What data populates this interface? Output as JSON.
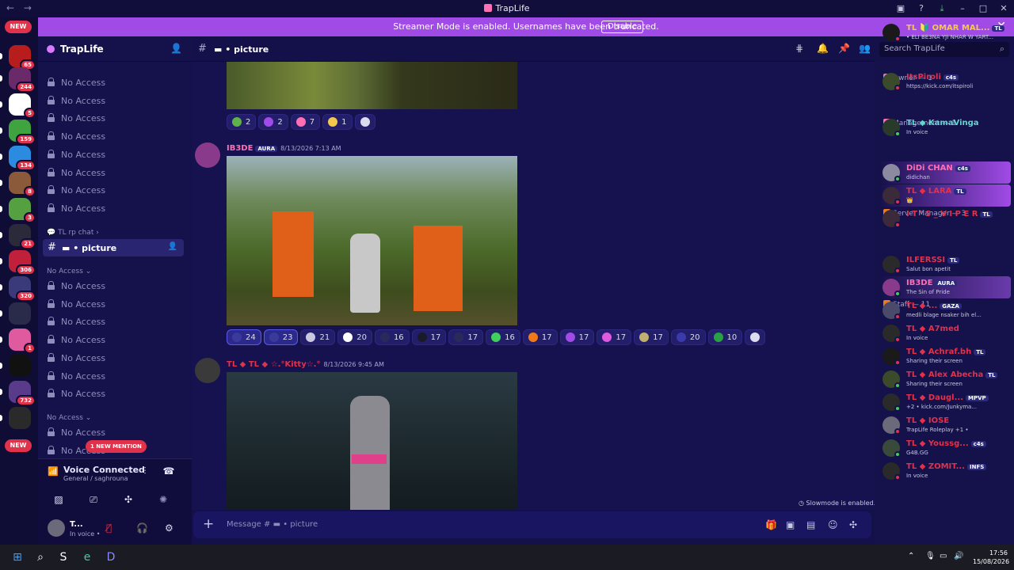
{
  "window": {
    "title": "TrapLife",
    "controls": [
      "▣",
      "?",
      "⤓",
      "–",
      "□",
      "✕"
    ]
  },
  "banner": {
    "text": "Streamer Mode is enabled. Usernames have been truncated.",
    "button": "Disable",
    "close": "✕"
  },
  "servers": {
    "new_top": "NEW",
    "new_bottom": "NEW",
    "items": [
      {
        "badge": "65",
        "color": "#b81d1d"
      },
      {
        "badge": "244",
        "color": "#6a2a6a"
      },
      {
        "badge": "5",
        "color": "#ffffff"
      },
      {
        "badge": "159",
        "color": "#3fa33f"
      },
      {
        "badge": "134",
        "color": "#2b8be0"
      },
      {
        "badge": "8",
        "color": "#8a5a3a"
      },
      {
        "badge": "3",
        "color": "#55a040"
      },
      {
        "badge": "21",
        "color": "#2a2a3a"
      },
      {
        "badge": "306",
        "color": "#c0203a"
      },
      {
        "badge": "320",
        "color": "#3a3a7a"
      },
      {
        "badge": "",
        "color": "#2a2a4a"
      },
      {
        "badge": "1",
        "color": "#e05aa0"
      },
      {
        "badge": "",
        "color": "#111111"
      },
      {
        "badge": "732",
        "color": "#5a3a8a"
      },
      {
        "badge": "",
        "color": "#2a2a2a"
      }
    ]
  },
  "sidebar": {
    "server_name": "TrapLife",
    "channels_top": [
      "No Access",
      "No Access",
      "No Access",
      "No Access",
      "No Access",
      "No Access",
      "No Access",
      "No Access"
    ],
    "category_rp": "TL rp chat",
    "selected_channel": "picture",
    "category_a": "No Access",
    "channels_mid": [
      "No Access",
      "No Access",
      "No Access",
      "No Access",
      "No Access",
      "No Access",
      "No Access"
    ],
    "category_b": "No Access",
    "channels_bottom": [
      "No Access",
      "No Access"
    ],
    "mention": "1 NEW MENTION"
  },
  "voice": {
    "status": "Voice Connected",
    "channel": "General / saghrouna"
  },
  "user": {
    "name": "T...",
    "status": "In voice •"
  },
  "chat": {
    "channel": "picture",
    "reactions_1": [
      {
        "count": "2",
        "color": "#5fb24a"
      },
      {
        "count": "2",
        "color": "#a04be6"
      },
      {
        "count": "7",
        "color": "#ff6fb3"
      },
      {
        "count": "1",
        "color": "#f2c94c"
      },
      {
        "count": "",
        "color": "#dcdcf0"
      }
    ],
    "msg2": {
      "author": "IB3DE",
      "tag": "AURA",
      "time": "8/13/2026 7:13 AM"
    },
    "reactions_2": [
      {
        "count": "24",
        "color": "#3a3a9a",
        "active": true
      },
      {
        "count": "23",
        "color": "#3a3a9a",
        "active": true
      },
      {
        "count": "21",
        "color": "#c8c8e0"
      },
      {
        "count": "20",
        "color": "#ffffff"
      },
      {
        "count": "16",
        "color": "#2a2a5a"
      },
      {
        "count": "17",
        "color": "#1a1a2a"
      },
      {
        "count": "17",
        "color": "#2a2a5a"
      },
      {
        "count": "16",
        "color": "#3fcf5a"
      },
      {
        "count": "17",
        "color": "#f07a1a"
      },
      {
        "count": "17",
        "color": "#a04be6"
      },
      {
        "count": "17",
        "color": "#e05ae0"
      },
      {
        "count": "17",
        "color": "#c0b070"
      },
      {
        "count": "20",
        "color": "#3a3aaa"
      },
      {
        "count": "10",
        "color": "#2aa045"
      },
      {
        "count": "",
        "color": "#dcdcf0"
      }
    ],
    "msg3": {
      "author": "TL ◆ TL ◆ ☆.°Kitty☆.°",
      "time": "8/13/2026 9:45 AM"
    },
    "composer_placeholder": "Message # ▬ • picture",
    "slowmode": "Slowmode is enabled."
  },
  "search": {
    "placeholder": "Search TrapLife"
  },
  "members": {
    "groups": [
      {
        "title": "Owner — 1",
        "color": "#ff6fb3"
      },
      {
        "title": "Management — 1",
        "color": "#ff6fb3"
      },
      {
        "title": "Developer — 1",
        "color": "#f2c94c"
      },
      {
        "title": "Server Manager — 3",
        "color": "#f07a1a"
      },
      {
        "title": "Staff — 11",
        "color": "#f07a1a"
      }
    ],
    "list": [
      {
        "name": "TL 🔰 OMAR MAL...",
        "tag": "TL",
        "sub": "• ELI BE3NA YJI NHAR W YART...",
        "color": "#f2c94c",
        "av": "#1a1a1a",
        "st": "#e0324a"
      },
      {
        "name": "ItsPiroli",
        "tag": "c4s",
        "sub": "https://kick.com/itspiroli",
        "color": "#e0324a",
        "av": "#3a4a2a",
        "st": "#e0324a"
      },
      {
        "name": "TL ◆ KamaVinga",
        "tag": "",
        "sub": "In voice",
        "color": "#5fd8d0",
        "av": "#2a3a2a",
        "st": "#3fcf5a"
      },
      {
        "name": "DiDi CHAN",
        "tag": "c4s",
        "sub": "didichan",
        "color": "#ff6fb3",
        "av": "#8a8aa0",
        "st": "#3fcf5a"
      },
      {
        "name": "TL ◆ LARA",
        "tag": "TL",
        "sub": "👑",
        "color": "#e0324a",
        "av": "#3a2a3a",
        "st": "#e0324a"
      },
      {
        "name": "I T ' S _ V I P E R",
        "tag": "TL",
        "sub": "",
        "color": "#e0324a",
        "av": "#3a2a3a",
        "st": "#e0324a"
      },
      {
        "name": "ILFERSSI",
        "tag": "TL",
        "sub": "Salut bon apetit",
        "color": "#e0324a",
        "av": "#2a2a2a",
        "st": "#e0324a"
      },
      {
        "name": "IB3DE",
        "tag": "AURA",
        "sub": "The Sin of Pride",
        "color": "#ff6fb3",
        "av": "#8a3a8a",
        "st": "#3fcf5a"
      },
      {
        "name": "TL ◆ ...",
        "tag": "GAZA",
        "sub": "medli blage nsaker bih el...",
        "color": "#e0324a",
        "av": "#4a4a6a",
        "st": "#e0324a"
      },
      {
        "name": "TL ◆ A7med",
        "tag": "",
        "sub": "In voice",
        "color": "#e0324a",
        "av": "#2a2a2a",
        "st": "#e0324a"
      },
      {
        "name": "TL ◆ Achraf.bh",
        "tag": "TL",
        "sub": "Sharing their screen",
        "color": "#e0324a",
        "av": "#1a1a1a",
        "st": "#e0324a"
      },
      {
        "name": "TL ◆ Alex Abecha",
        "tag": "TL",
        "sub": "Sharing their screen",
        "color": "#e0324a",
        "av": "#3a4a2a",
        "st": "#3fcf5a"
      },
      {
        "name": "TL ◆ Daugl...",
        "tag": "MPVP",
        "sub": "+2 • kick.com/Junkyma...",
        "color": "#e0324a",
        "av": "#2a2a2a",
        "st": "#3fcf5a"
      },
      {
        "name": "TL ◆ IOSE",
        "tag": "",
        "sub": "TrapLife Roleplay +1 •",
        "color": "#e0324a",
        "av": "#6a6a7a",
        "st": "#e0324a"
      },
      {
        "name": "TL ◆ Youssg...",
        "tag": "c4s",
        "sub": "G4B.GG",
        "color": "#e0324a",
        "av": "#3a4a3a",
        "st": "#3fcf5a"
      },
      {
        "name": "TL ◆ ZOMIT...",
        "tag": "INFS",
        "sub": "In voice",
        "color": "#e0324a",
        "av": "#2a2a2a",
        "st": "#e0324a"
      }
    ]
  },
  "taskbar": {
    "time": "17:56",
    "date": "15/08/2026",
    "apps": [
      "⊞",
      "⌕",
      "S",
      "e",
      "D"
    ]
  }
}
